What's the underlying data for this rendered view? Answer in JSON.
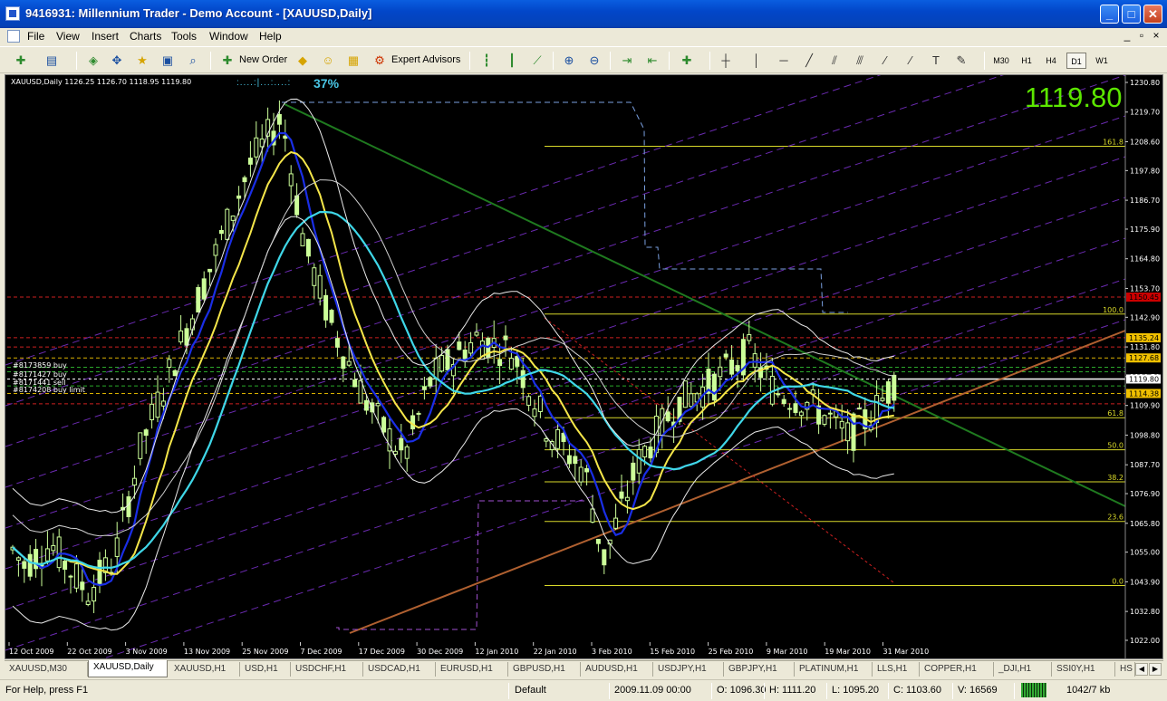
{
  "window": {
    "title": "9416931: Millennium Trader - Demo Account - [XAUUSD,Daily]"
  },
  "menu": [
    "File",
    "View",
    "Insert",
    "Charts",
    "Tools",
    "Window",
    "Help"
  ],
  "toolbar": {
    "new_order": "New Order",
    "expert_advisors": "Expert Advisors",
    "timeframes": [
      "M30",
      "H1",
      "H4",
      "D1",
      "W1"
    ],
    "active_timeframe": "D1"
  },
  "chart": {
    "info": "XAUUSD,Daily  1126.25 1126.70 1118.95 1119.80",
    "progress_dots": ":....:|...:....:",
    "progress_pct": "37%",
    "big_price": "1119.80",
    "order_labels": [
      "#8173859 buy",
      "#8171427 buy",
      "#8171441 sell",
      "#8174208 buy limit"
    ],
    "colors": {
      "background": "#000000",
      "candle": "#ccff99",
      "price_label": "#5ce600"
    }
  },
  "chart_data": {
    "type": "candlestick",
    "symbol": "XAUUSD",
    "timeframe": "Daily",
    "y_ticks": [
      "1230.80",
      "1219.70",
      "1208.60",
      "1197.80",
      "1186.70",
      "1175.90",
      "1164.80",
      "1153.70",
      "1142.90",
      "1131.80",
      "1120.70",
      "1109.90",
      "1098.80",
      "1087.70",
      "1076.90",
      "1065.80",
      "1055.00",
      "1043.90",
      "1032.80",
      "1022.00"
    ],
    "ylim": [
      1022.0,
      1230.8
    ],
    "x_ticks": [
      "12 Oct 2009",
      "22 Oct 2009",
      "3 Nov 2009",
      "13 Nov 2009",
      "25 Nov 2009",
      "7 Dec 2009",
      "17 Dec 2009",
      "30 Dec 2009",
      "12 Jan 2010",
      "22 Jan 2010",
      "3 Feb 2010",
      "15 Feb 2010",
      "25 Feb 2010",
      "9 Mar 2010",
      "19 Mar 2010",
      "31 Mar 2010"
    ],
    "fibonacci_levels": [
      {
        "label": "161.8",
        "price": 1206.9
      },
      {
        "label": "100.0",
        "price": 1144.1
      },
      {
        "label": "61.8",
        "price": 1105.3
      },
      {
        "label": "50.0",
        "price": 1093.3
      },
      {
        "label": "38.2",
        "price": 1081.3
      },
      {
        "label": "23.6",
        "price": 1066.5
      },
      {
        "label": "0.0",
        "price": 1042.5
      }
    ],
    "price_tags": [
      {
        "text": "1150.45",
        "price": 1150.45,
        "color": "#cc0000"
      },
      {
        "text": "1135.24",
        "price": 1135.24,
        "color": "#f0c000"
      },
      {
        "text": "1127.68",
        "price": 1127.68,
        "color": "#f0c000"
      },
      {
        "text": "1119.80",
        "price": 1119.8,
        "color": "#ffffff"
      },
      {
        "text": "1114.38",
        "price": 1114.38,
        "color": "#f0c000"
      }
    ],
    "current_price": 1119.8,
    "open": 1126.25,
    "high": 1126.7,
    "low": 1118.95,
    "close": 1119.8
  },
  "tabs": [
    "XAUUSD,M30",
    "XAUUSD,Daily",
    "XAUUSD,H1",
    "USD,H1",
    "USDCHF,H1",
    "USDCAD,H1",
    "EURUSD,H1",
    "GBPUSD,H1",
    "AUDUSD,H1",
    "USDJPY,H1",
    "GBPJPY,H1",
    "PLATINUM,H1",
    "LLS,H1",
    "COPPER,H1",
    "_DJI,H1",
    "SSI0Y,H1",
    "HS"
  ],
  "active_tab": "XAUUSD,Daily",
  "status": {
    "help": "For Help, press F1",
    "profile": "Default",
    "datetime": "2009.11.09 00:00",
    "open": "O: 1096.30",
    "high": "H: 1111.20",
    "low": "L: 1095.20",
    "close": "C: 1103.60",
    "volume": "V: 16569",
    "traffic": "1042/7 kb"
  }
}
